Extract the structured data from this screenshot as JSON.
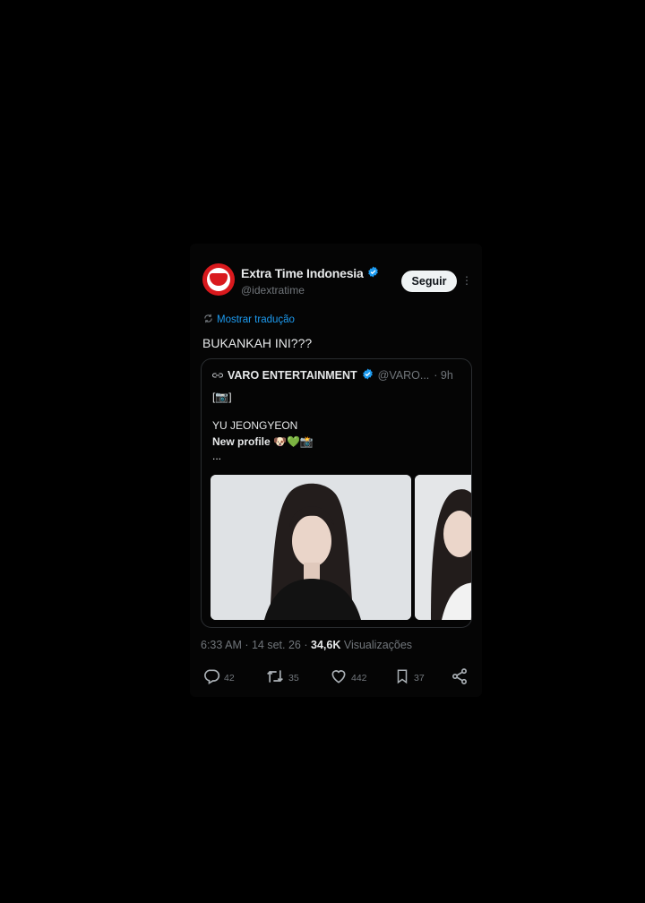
{
  "tweet": {
    "author_name": "Extra Time Indonesia",
    "author_handle": "@idextratime",
    "follow_label": "Seguir",
    "more_label": "⋮",
    "translate_label": "Mostrar tradução",
    "text": "BUKANKAH INI???",
    "timestamp": "6:33 AM · 14 set. 26 ·",
    "views_count": "34,6K",
    "views_label": "Visualizações"
  },
  "quote": {
    "author_name": "VARO ENTERTAINMENT",
    "author_handle": "@VARO...",
    "time": "· 9h",
    "line1": "[📷]",
    "line2": "YU JEONGYEON",
    "line3": "New profile 🐶💚📸",
    "line4": "..."
  },
  "actions": {
    "replies": "42",
    "retweets": "35",
    "likes": "442",
    "bookmarks": "37"
  },
  "colors": {
    "background": "#000000",
    "accent": "#1d9bf0",
    "avatar": "#d9191d",
    "muted": "#71767b"
  },
  "icons": [
    "verified-badge-icon",
    "translate-icon",
    "link-icon",
    "reply-icon",
    "retweet-icon",
    "like-icon",
    "bookmark-icon",
    "share-icon"
  ]
}
